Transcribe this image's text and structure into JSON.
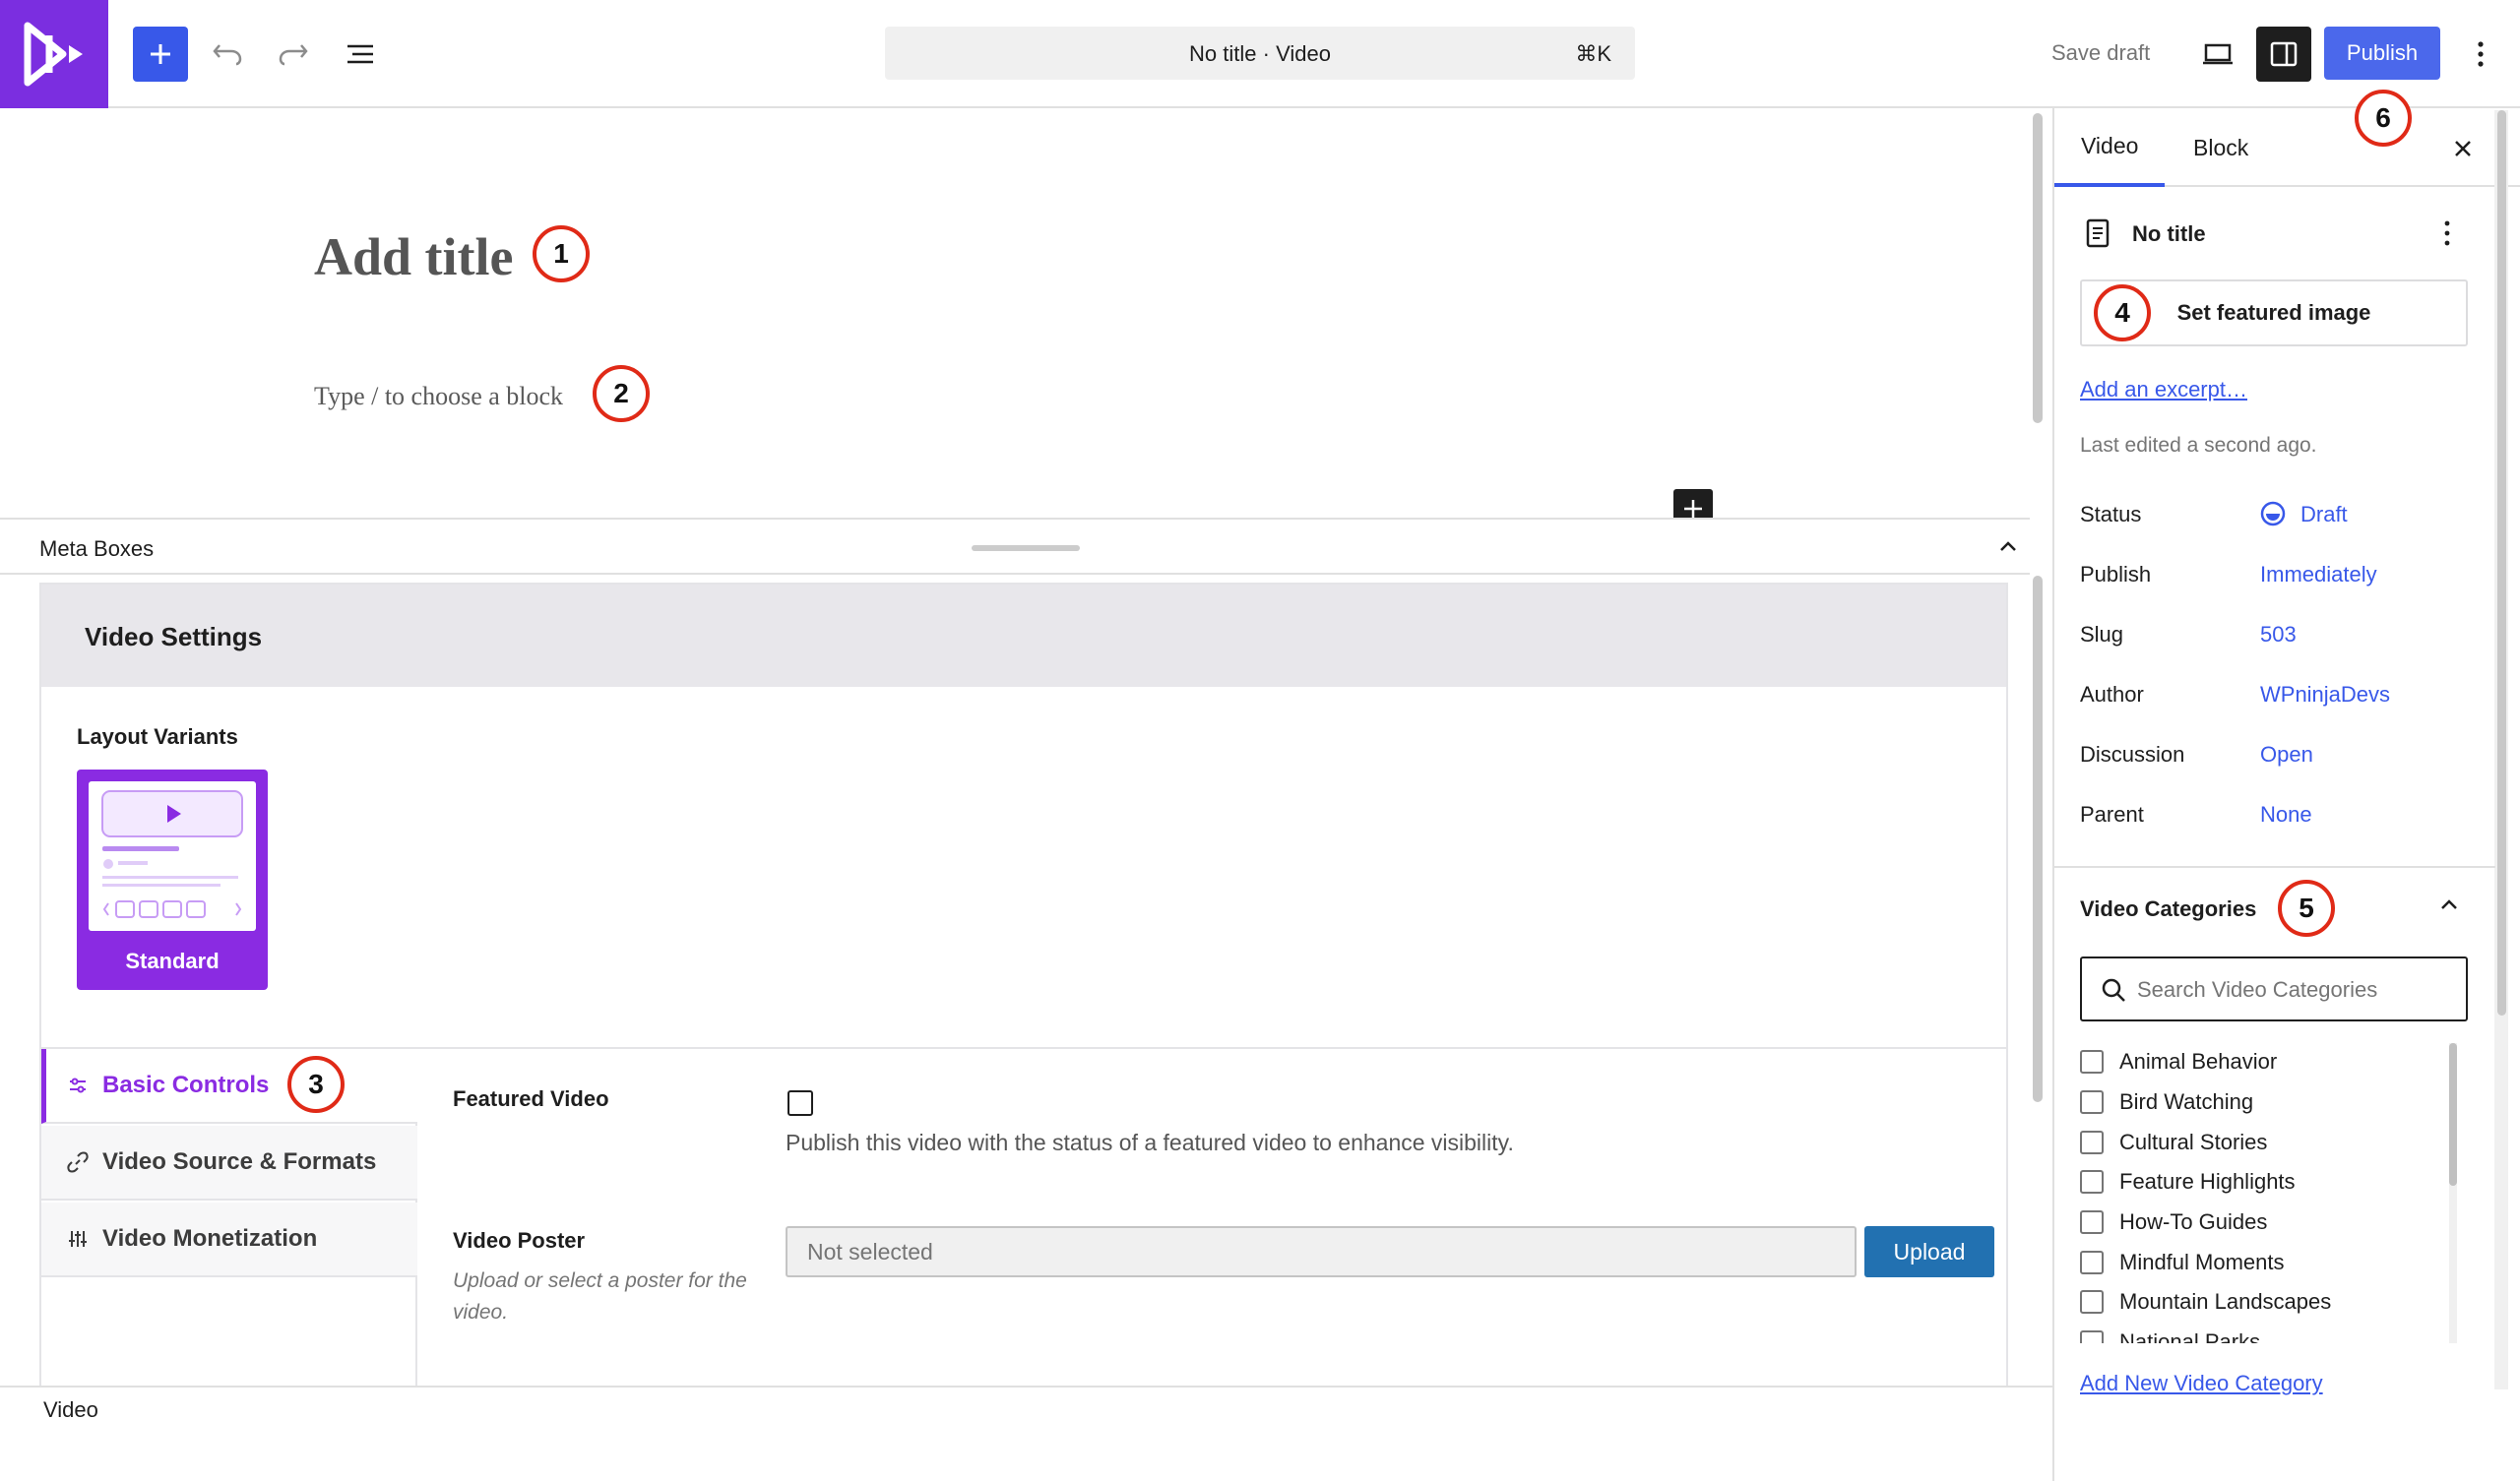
{
  "header": {
    "command_title": "No title · Video",
    "command_shortcut": "⌘K",
    "save_draft": "Save draft",
    "publish": "Publish"
  },
  "editor": {
    "title_placeholder": "Add title",
    "block_placeholder": "Type / to choose a block"
  },
  "meta_boxes": {
    "label": "Meta Boxes"
  },
  "video_settings": {
    "heading": "Video Settings",
    "layout_variants_label": "Layout Variants",
    "variant_name": "Standard",
    "tabs": [
      "Basic Controls",
      "Video Source & Formats",
      "Video Monetization"
    ],
    "featured_video": {
      "label": "Featured Video",
      "description": "Publish this video with the status of a featured video to enhance visibility."
    },
    "video_poster": {
      "label": "Video Poster",
      "help": "Upload or select a poster for the video.",
      "value": "Not selected",
      "upload": "Upload"
    }
  },
  "footer": {
    "breadcrumb": "Video"
  },
  "sidebar": {
    "tabs": [
      "Video",
      "Block"
    ],
    "post_title": "No title",
    "set_featured_image": "Set featured image",
    "add_excerpt": "Add an excerpt…",
    "last_edited": "Last edited a second ago.",
    "rows": [
      {
        "label": "Status",
        "value": "Draft"
      },
      {
        "label": "Publish",
        "value": "Immediately"
      },
      {
        "label": "Slug",
        "value": "503"
      },
      {
        "label": "Author",
        "value": "WPninjaDevs"
      },
      {
        "label": "Discussion",
        "value": "Open"
      },
      {
        "label": "Parent",
        "value": "None"
      }
    ],
    "video_categories": {
      "title": "Video Categories",
      "search_placeholder": "Search Video Categories",
      "items": [
        "Animal Behavior",
        "Bird Watching",
        "Cultural Stories",
        "Feature Highlights",
        "How-To Guides",
        "Mindful Moments",
        "Mountain Landscapes",
        "National Parks"
      ],
      "add_new": "Add New Video Category"
    }
  },
  "markers": [
    "1",
    "2",
    "3",
    "4",
    "5",
    "6"
  ],
  "colors": {
    "accent": "#3858e9",
    "brand": "#7b2ee0",
    "marker": "#e02a17"
  }
}
